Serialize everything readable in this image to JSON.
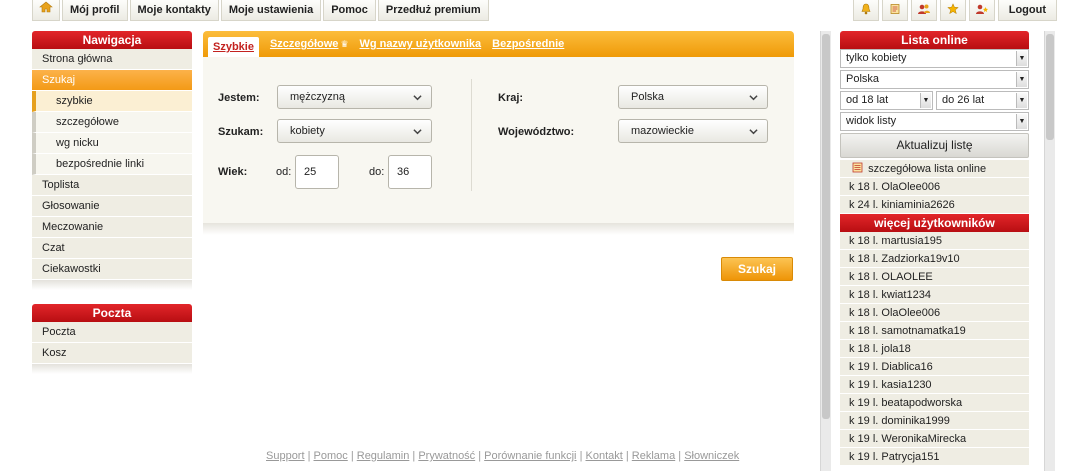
{
  "topnav": {
    "home_icon": "home-icon",
    "items": [
      "Mój profil",
      "Moje kontakty",
      "Moje ustawienia",
      "Pomoc",
      "Przedłuż premium"
    ],
    "right_icons": [
      "bell-icon",
      "notes-icon",
      "users-icon",
      "star-icon",
      "user-star-icon"
    ],
    "logout": "Logout"
  },
  "sidebar": {
    "nav_title": "Nawigacja",
    "nav_items": [
      {
        "label": "Strona główna",
        "level": 0,
        "active": false
      },
      {
        "label": "Szukaj",
        "level": 0,
        "active": true
      },
      {
        "label": "szybkie",
        "level": 1,
        "active": true
      },
      {
        "label": "szczegółowe",
        "level": 1,
        "active": false
      },
      {
        "label": "wg nicku",
        "level": 1,
        "active": false
      },
      {
        "label": "bezpośrednie linki",
        "level": 1,
        "active": false
      },
      {
        "label": "Toplista",
        "level": 0,
        "active": false
      },
      {
        "label": "Głosowanie",
        "level": 0,
        "active": false
      },
      {
        "label": "Meczowanie",
        "level": 0,
        "active": false
      },
      {
        "label": "Czat",
        "level": 0,
        "active": false
      },
      {
        "label": "Ciekawostki",
        "level": 0,
        "active": false
      }
    ],
    "mail_title": "Poczta",
    "mail_items": [
      "Poczta",
      "Kosz"
    ]
  },
  "search": {
    "tabs": [
      {
        "label": "Szybkie",
        "active": true
      },
      {
        "label": "Szczegółowe",
        "active": false,
        "premium": true
      },
      {
        "label": "Wg nazwy użytkownika",
        "active": false
      },
      {
        "label": "Bezpośrednie",
        "active": false
      }
    ],
    "jestem_label": "Jestem:",
    "jestem_value": "mężczyzną",
    "szukam_label": "Szukam:",
    "szukam_value": "kobiety",
    "wiek_label": "Wiek:",
    "od_label": "od:",
    "od_value": "25",
    "do_label": "do:",
    "do_value": "36",
    "kraj_label": "Kraj:",
    "kraj_value": "Polska",
    "woj_label": "Województwo:",
    "woj_value": "mazowieckie",
    "submit": "Szukaj"
  },
  "online": {
    "title": "Lista online",
    "filter_gender": "tylko kobiety",
    "filter_country": "Polska",
    "filter_from": "od 18 lat",
    "filter_to": "do 26 lat",
    "filter_view": "widok listy",
    "update_button": "Aktualizuj listę",
    "detailed_link": "szczegółowa lista online",
    "top_users": [
      "k 18 l. OlaOlee006",
      "k 24 l. kiniaminia2626"
    ],
    "more_title": "więcej użytkowników",
    "users": [
      "k 18 l. martusia195",
      "k 18 l. Zadziorka19v10",
      "k 18 l. OLAOLEE",
      "k 18 l. kwiat1234",
      "k 18 l. OlaOlee006",
      "k 18 l. samotnamatka19",
      "k 18 l. jola18",
      "k 19 l. Diablica16",
      "k 19 l. kasia1230",
      "k 19 l. beatapodworska",
      "k 19 l. dominika1999",
      "k 19 l. WeronikaMirecka",
      "k 19 l. Patrycja151"
    ]
  },
  "footer": {
    "links": [
      "Support",
      "Pomoc",
      "Regulamin",
      "Prywatność",
      "Porównanie funkcji",
      "Kontakt",
      "Reklama",
      "Słowniczek"
    ]
  },
  "colors": {
    "accent_red": "#c3221f",
    "accent_orange": "#f39a16"
  }
}
